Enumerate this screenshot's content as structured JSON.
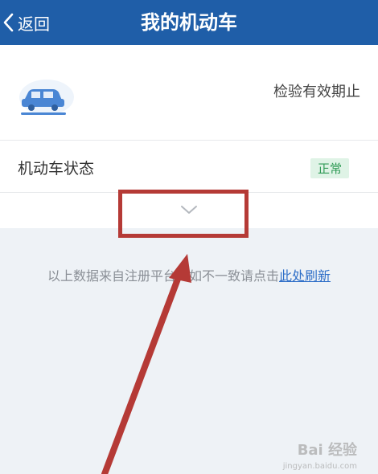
{
  "header": {
    "back_label": "返回",
    "title": "我的机动车",
    "color": "#1f5ea8"
  },
  "vehicle": {
    "icon": "car-icon",
    "expiry_label": "检验有效期止"
  },
  "status": {
    "label": "机动车状态",
    "badge": "正常",
    "badge_color": "#2f9a55"
  },
  "expand": {
    "icon": "chevron-down-icon"
  },
  "note": {
    "text": "以上数据来自注册平台，如不一致请点击",
    "link": "此处刷新",
    "link_color": "#2f6fc8"
  },
  "annotation": {
    "highlight_color": "#b53a36"
  },
  "watermark": {
    "text": "Bai 经验",
    "sub": "jingyan.baidu.com"
  }
}
